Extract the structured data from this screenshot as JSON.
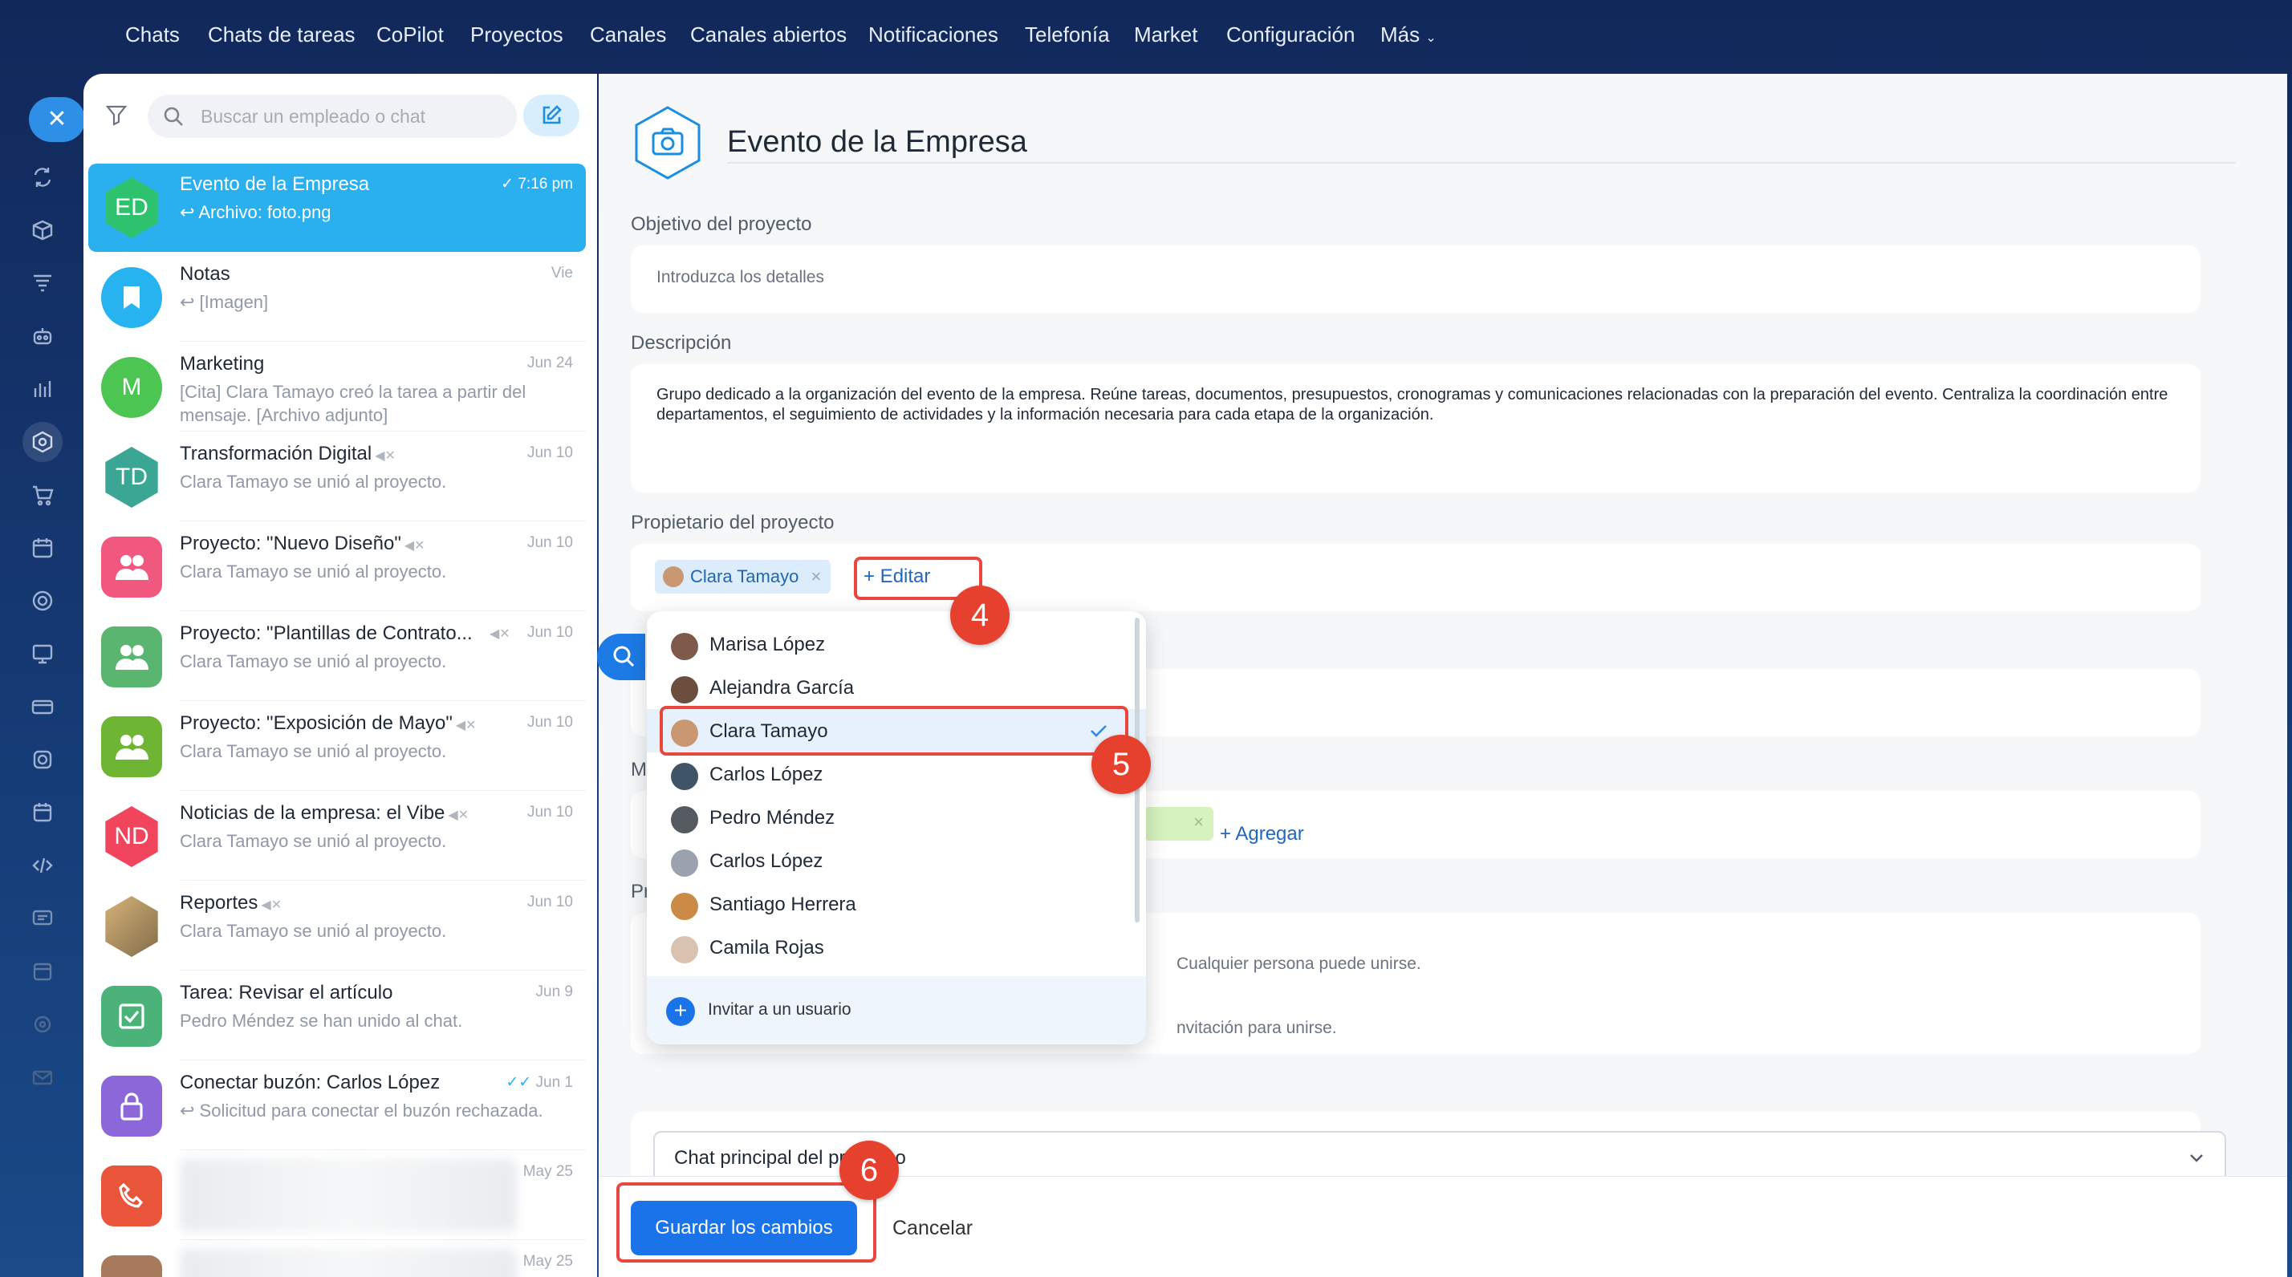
{
  "nav": {
    "items": [
      "Chats",
      "Chats de tareas",
      "CoPilot",
      "Proyectos",
      "Canales",
      "Canales abiertos",
      "Notificaciones",
      "Telefonía",
      "Market",
      "Configuración",
      "Más"
    ]
  },
  "sidebar_search": {
    "placeholder": "Buscar un empleado o chat"
  },
  "chats": [
    {
      "avatar_text": "ED",
      "title": "Evento de la Empresa",
      "time": "7:16 pm",
      "preview": "↩ Archivo: foto.png",
      "avatar_color": "#2fc26e",
      "read": true
    },
    {
      "avatar_text": "",
      "title": "Notas",
      "time": "Vie",
      "preview": "↩ [Imagen]",
      "avatar_color": "#27b2f0"
    },
    {
      "avatar_text": "M",
      "title": "Marketing",
      "time": "Jun 24",
      "preview": "[Cita] Clara Tamayo creó la tarea a partir del mensaje. [Archivo adjunto]",
      "avatar_color": "#4cc553"
    },
    {
      "avatar_text": "TD",
      "title": "Transformación Digital",
      "time": "Jun 10",
      "preview": "Clara Tamayo se unió al proyecto.",
      "avatar_color": "#3aa693",
      "muted": true
    },
    {
      "avatar_text": "",
      "title": "Proyecto: \"Nuevo Diseño\"",
      "time": "Jun 10",
      "preview": "Clara Tamayo se unió al proyecto.",
      "avatar_color": "#f0587f",
      "muted": true
    },
    {
      "avatar_text": "",
      "title": "Proyecto: \"Plantillas de Contrato...",
      "time": "Jun 10",
      "preview": "Clara Tamayo se unió al proyecto.",
      "avatar_color": "#5ab571",
      "muted": true
    },
    {
      "avatar_text": "",
      "title": "Proyecto: \"Exposición de Mayo\"",
      "time": "Jun 10",
      "preview": "Clara Tamayo se unió al proyecto.",
      "avatar_color": "#6fb534",
      "muted": true
    },
    {
      "avatar_text": "ND",
      "title": "Noticias de la empresa: el Vibe",
      "time": "Jun 10",
      "preview": "Clara Tamayo se unió al proyecto.",
      "avatar_color": "#f0455d",
      "muted": true
    },
    {
      "avatar_text": "",
      "title": "Reportes",
      "time": "Jun 10",
      "preview": "Clara Tamayo se unió al proyecto.",
      "avatar_color": "#c5a36e",
      "muted": true
    },
    {
      "avatar_text": "",
      "title": "Tarea: Revisar el artículo",
      "time": "Jun 9",
      "preview": "Pedro Méndez se han unido al chat.",
      "avatar_color": "#4bb37a"
    },
    {
      "avatar_text": "",
      "title": "Conectar buzón: Carlos López",
      "time": "Jun 1",
      "preview": "↩ Solicitud para conectar el buzón rechazada.",
      "avatar_color": "#8b67d9",
      "read": true
    },
    {
      "avatar_text": "",
      "title": "",
      "time": "May 25",
      "preview": "",
      "avatar_color": "#e8553a",
      "blurred": true
    },
    {
      "avatar_text": "",
      "title": "",
      "time": "May 25",
      "preview": "",
      "avatar_color": "#a87a5c",
      "blurred": true
    }
  ],
  "project": {
    "title": "Evento de la Empresa",
    "objective_label": "Objetivo del proyecto",
    "objective_placeholder": "Introduzca los detalles",
    "description_label": "Descripción",
    "description": "Grupo dedicado a la organización del evento de la empresa. Reúne tareas, documentos, presupuestos, cronogramas y comunicaciones relacionadas con la preparación del evento. Centraliza la coordinación entre departamentos, el seguimiento de actividades y la información necesaria para cada etapa de la organización.",
    "owner_label": "Propietario del proyecto",
    "owner_chip": "Clara Tamayo",
    "edit_label": "+ Editar",
    "members_label_fragment": "M",
    "add_label": "+ Agregar",
    "privacy_label_fragment": "Pr",
    "privacy_option1_fragment": "Cualquier persona puede unirse.",
    "privacy_option2_fragment": "nvitación para unirse.",
    "chat_select_label": "Chat principal del pr",
    "chat_select_tail": "o"
  },
  "dropdown": {
    "users": [
      {
        "name": "Marisa López",
        "avatar_color": "#7d5a4a"
      },
      {
        "name": "Alejandra García",
        "avatar_color": "#6b4e3d"
      },
      {
        "name": "Clara Tamayo",
        "avatar_color": "#c99772",
        "selected": true
      },
      {
        "name": "Carlos López",
        "avatar_color": "#3f5466"
      },
      {
        "name": "Pedro Méndez",
        "avatar_color": "#555a60"
      },
      {
        "name": "Carlos López",
        "avatar_color": "#9aa3ad"
      },
      {
        "name": "Santiago Herrera",
        "avatar_color": "#c98b45"
      },
      {
        "name": "Camila Rojas",
        "avatar_color": "#d9c2b0"
      }
    ],
    "invite_label": "Invitar a un usuario"
  },
  "actions": {
    "save": "Guardar los cambios",
    "cancel": "Cancelar"
  },
  "badges": [
    "4",
    "5",
    "6"
  ],
  "colors": {
    "accent": "#1a73e8",
    "highlight": "#e9473e",
    "active_chat": "#2ab0ef"
  }
}
